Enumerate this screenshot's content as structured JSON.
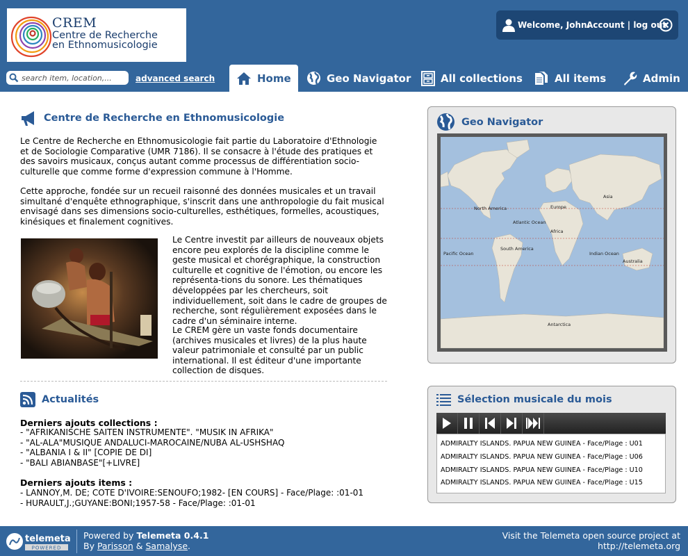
{
  "header": {
    "logo": {
      "short": "CREM",
      "line1": "Centre de Recherche",
      "line2": "en Ethnomusicologie"
    },
    "account": {
      "welcome": "Welcome, John.",
      "account_link": "Account | log out"
    },
    "search": {
      "placeholder": "search item, location,..."
    },
    "advanced_search": "advanced search",
    "nav": [
      {
        "label": "Home",
        "icon": "home-icon",
        "active": true
      },
      {
        "label": "Geo Navigator",
        "icon": "globe-icon"
      },
      {
        "label": "All collections",
        "icon": "cabinet-icon"
      },
      {
        "label": "All items",
        "icon": "documents-icon"
      },
      {
        "label": "Admin",
        "icon": "wrench-icon"
      }
    ]
  },
  "intro": {
    "title": "Centre de Recherche en Ethnomusicologie",
    "p1": "Le Centre de Recherche en Ethnomusicologie fait partie du Laboratoire d'Ethnologie et de Sociologie Comparative (UMR 7186). Il se consacre à l'étude des pratiques et des savoirs musicaux, conçus autant comme processus de différentiation socio-culturelle que comme forme d'expression commune à l'Homme.",
    "p2": "Cette approche, fondée sur un recueil raisonné des données musicales et un travail simultané d'enquête ethnographique, s'inscrit dans une anthropologie du fait musical envisagé dans ses dimensions socio-culturelles, esthétiques, formelles, acoustiques, kinésiques et finalement cognitives.",
    "p3": "Le Centre investit par ailleurs de nouveaux objets encore peu explorés de la discipline comme le geste musical et chorégraphique, la construction culturelle et cognitive de l'émotion, ou encore les représenta-tions du sonore. Les thématiques développées par les chercheurs, soit individuellement, soit dans le cadre de groupes de recherche, sont régulièrement exposées dans le cadre d'un séminaire interne.",
    "p4": "Le CREM gère un vaste fonds documentaire (archives musicales et livres) de la plus haute valeur patrimoniale et consulté par un public international. Il est éditeur d'une importante collection de disques."
  },
  "news": {
    "title": "Actualités",
    "collections_heading": "Derniers ajouts collections :",
    "collections": [
      "- \"AFRIKANISCHE SAITEN INSTRUMENTE\". \"MUSIK IN AFRIKA\"",
      "- \"AL-ALA\"MUSIQUE ANDALUCI-MAROCAINE/NUBA AL-USHSHAQ",
      "- \"ALBANIA I & II\" [COPIE DE DI]",
      "- \"BALI ABIANBASE\"[+LIVRE]"
    ],
    "items_heading": "Derniers ajouts items :",
    "items": [
      "- LANNOY,M. DE; COTE D'IVOIRE:SENOUFO;1982- [EN COURS] - Face/Plage: :01-01",
      "- HURAULT,J.;GUYANE:BONI;1957-58 - Face/Plage: :01-01"
    ]
  },
  "geo": {
    "title": "Geo Navigator",
    "labels": [
      "North America",
      "Europe",
      "Asia",
      "Atlantic Ocean",
      "Africa",
      "Pacific Ocean",
      "South America",
      "Indian Ocean",
      "Australia",
      "Antarctica"
    ]
  },
  "music": {
    "title": "Sélection musicale du mois",
    "playlist": [
      "ADMIRALTY ISLANDS. PAPUA NEW GUINEA - Face/Plage : U01",
      "ADMIRALTY ISLANDS. PAPUA NEW GUINEA - Face/Plage : U06",
      "ADMIRALTY ISLANDS. PAPUA NEW GUINEA - Face/Plage : U10",
      "ADMIRALTY ISLANDS. PAPUA NEW GUINEA - Face/Plage : U15"
    ]
  },
  "footer": {
    "tm_name": "telemeta",
    "tm_tag": "POWERED",
    "powered_prefix": "Powered by ",
    "powered_name": "Telemeta 0.4.1",
    "by": "By ",
    "parisson": "Parisson",
    "amp": " & ",
    "samalyse": "Samalyse",
    "dot": ".",
    "visit_line1": "Visit the Telemeta open source project at",
    "visit_line2": "http://telemeta.org"
  },
  "colors": {
    "header_bg": "#33669c",
    "title_blue": "#2a5a96",
    "account_bg": "#1d4674"
  }
}
